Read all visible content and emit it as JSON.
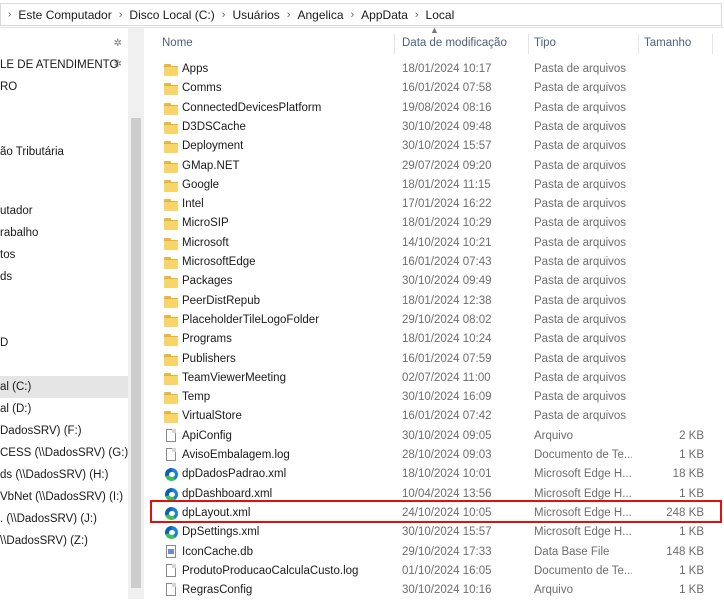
{
  "address": {
    "crumbs": [
      "Este Computador",
      "Disco Local (C:)",
      "Usuários",
      "Angelica",
      "AppData",
      "Local"
    ]
  },
  "nav": {
    "items": [
      {
        "label": "LE DE ATENDIMENTO",
        "pinned": true
      },
      {
        "label": "RO"
      },
      {
        "label": ""
      },
      {
        "label": "ão Tributária"
      },
      {
        "label": ""
      },
      {
        "label": ""
      },
      {
        "label": "utador"
      },
      {
        "label": "rabalho"
      },
      {
        "label": "tos"
      },
      {
        "label": "ds"
      },
      {
        "label": ""
      },
      {
        "label": "D"
      },
      {
        "label": ""
      },
      {
        "label": "al (C:)",
        "selected": true
      },
      {
        "label": "al (D:)"
      },
      {
        "label": "DadosSRV) (F:)"
      },
      {
        "label": "CESS (\\\\DadosSRV) (G:)"
      },
      {
        "label": "ds (\\\\DadosSRV) (H:)"
      },
      {
        "label": "VbNet (\\\\DadosSRV) (I:)"
      },
      {
        "label": ". (\\\\DadosSRV) (J:)"
      },
      {
        "label": "\\\\DadosSRV) (Z:)"
      }
    ]
  },
  "columns": {
    "name": "Nome",
    "date": "Data de modificação",
    "type": "Tipo",
    "size": "Tamanho"
  },
  "files": [
    {
      "name": "Apps",
      "date": "18/01/2024 10:17",
      "type": "Pasta de arquivos",
      "size": "",
      "icon": "folder-icon"
    },
    {
      "name": "Comms",
      "date": "16/01/2024 07:58",
      "type": "Pasta de arquivos",
      "size": "",
      "icon": "folder-icon"
    },
    {
      "name": "ConnectedDevicesPlatform",
      "date": "19/08/2024 08:16",
      "type": "Pasta de arquivos",
      "size": "",
      "icon": "folder-icon"
    },
    {
      "name": "D3DSCache",
      "date": "30/10/2024 09:48",
      "type": "Pasta de arquivos",
      "size": "",
      "icon": "folder-icon"
    },
    {
      "name": "Deployment",
      "date": "30/10/2024 15:57",
      "type": "Pasta de arquivos",
      "size": "",
      "icon": "folder-icon"
    },
    {
      "name": "GMap.NET",
      "date": "29/07/2024 09:20",
      "type": "Pasta de arquivos",
      "size": "",
      "icon": "folder-icon"
    },
    {
      "name": "Google",
      "date": "18/01/2024 11:15",
      "type": "Pasta de arquivos",
      "size": "",
      "icon": "folder-icon"
    },
    {
      "name": "Intel",
      "date": "17/01/2024 16:22",
      "type": "Pasta de arquivos",
      "size": "",
      "icon": "folder-icon"
    },
    {
      "name": "MicroSIP",
      "date": "18/01/2024 10:29",
      "type": "Pasta de arquivos",
      "size": "",
      "icon": "folder-icon"
    },
    {
      "name": "Microsoft",
      "date": "14/10/2024 10:21",
      "type": "Pasta de arquivos",
      "size": "",
      "icon": "folder-icon"
    },
    {
      "name": "MicrosoftEdge",
      "date": "16/01/2024 07:43",
      "type": "Pasta de arquivos",
      "size": "",
      "icon": "folder-icon"
    },
    {
      "name": "Packages",
      "date": "30/10/2024 09:49",
      "type": "Pasta de arquivos",
      "size": "",
      "icon": "folder-icon"
    },
    {
      "name": "PeerDistRepub",
      "date": "18/01/2024 12:38",
      "type": "Pasta de arquivos",
      "size": "",
      "icon": "folder-icon"
    },
    {
      "name": "PlaceholderTileLogoFolder",
      "date": "29/10/2024 08:02",
      "type": "Pasta de arquivos",
      "size": "",
      "icon": "folder-icon"
    },
    {
      "name": "Programs",
      "date": "18/01/2024 10:24",
      "type": "Pasta de arquivos",
      "size": "",
      "icon": "folder-icon"
    },
    {
      "name": "Publishers",
      "date": "16/01/2024 07:59",
      "type": "Pasta de arquivos",
      "size": "",
      "icon": "folder-icon"
    },
    {
      "name": "TeamViewerMeeting",
      "date": "02/07/2024 11:00",
      "type": "Pasta de arquivos",
      "size": "",
      "icon": "folder-icon"
    },
    {
      "name": "Temp",
      "date": "30/10/2024 16:09",
      "type": "Pasta de arquivos",
      "size": "",
      "icon": "folder-icon"
    },
    {
      "name": "VirtualStore",
      "date": "16/01/2024 07:42",
      "type": "Pasta de arquivos",
      "size": "",
      "icon": "folder-icon"
    },
    {
      "name": "ApiConfig",
      "date": "30/10/2024 09:05",
      "type": "Arquivo",
      "size": "2 KB",
      "icon": "file-icon"
    },
    {
      "name": "AvisoEmbalagem.log",
      "date": "28/10/2024 09:03",
      "type": "Documento de Te...",
      "size": "1 KB",
      "icon": "file-icon"
    },
    {
      "name": "dpDadosPadrao.xml",
      "date": "18/10/2024 10:01",
      "type": "Microsoft Edge H...",
      "size": "18 KB",
      "icon": "edge-icon"
    },
    {
      "name": "dpDashboard.xml",
      "date": "10/04/2024 13:56",
      "type": "Microsoft Edge H...",
      "size": "1 KB",
      "icon": "edge-icon"
    },
    {
      "name": "dpLayout.xml",
      "date": "24/10/2024 10:05",
      "type": "Microsoft Edge H...",
      "size": "248 KB",
      "icon": "edge-icon"
    },
    {
      "name": "DpSettings.xml",
      "date": "30/10/2024 15:57",
      "type": "Microsoft Edge H...",
      "size": "1 KB",
      "icon": "edge-icon"
    },
    {
      "name": "IconCache.db",
      "date": "29/10/2024 17:33",
      "type": "Data Base File",
      "size": "148 KB",
      "icon": "db-icon"
    },
    {
      "name": "ProdutoProducaoCalculaCusto.log",
      "date": "01/10/2024 16:05",
      "type": "Documento de Te...",
      "size": "1 KB",
      "icon": "file-icon"
    },
    {
      "name": "RegrasConfig",
      "date": "30/10/2024 10:16",
      "type": "Arquivo",
      "size": "1 KB",
      "icon": "file-icon"
    }
  ],
  "highlighted_file": "dpLayout.xml",
  "colors": {
    "highlight_border": "#e01010",
    "folder": "#f8d56b",
    "selected_nav": "#e5e5e5"
  }
}
